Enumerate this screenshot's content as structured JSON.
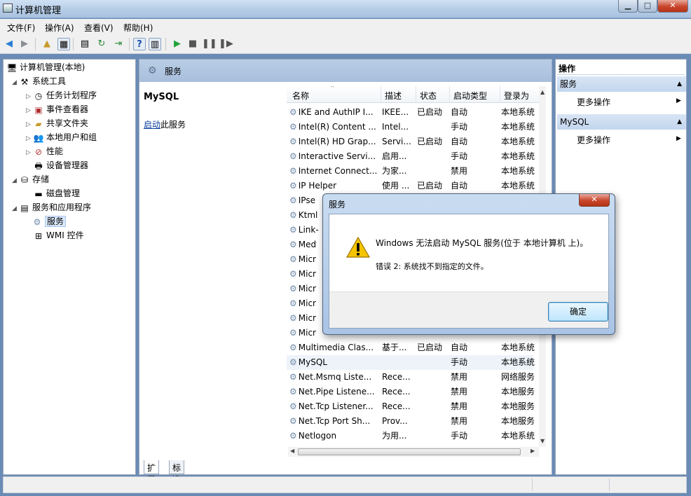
{
  "window": {
    "title": "计算机管理",
    "min": "▁",
    "max": "□",
    "close": "✕"
  },
  "menu": [
    "文件(F)",
    "操作(A)",
    "查看(V)",
    "帮助(H)"
  ],
  "tree": [
    {
      "label": "计算机管理(本地)",
      "icon": "computer-management-icon"
    },
    {
      "label": "系统工具",
      "icon": "tools-icon"
    },
    {
      "label": "任务计划程序",
      "icon": "task-scheduler-icon"
    },
    {
      "label": "事件查看器",
      "icon": "event-viewer-icon"
    },
    {
      "label": "共享文件夹",
      "icon": "shared-folder-icon"
    },
    {
      "label": "本地用户和组",
      "icon": "users-icon"
    },
    {
      "label": "性能",
      "icon": "performance-icon"
    },
    {
      "label": "设备管理器",
      "icon": "device-manager-icon"
    },
    {
      "label": "存储",
      "icon": "storage-icon"
    },
    {
      "label": "磁盘管理",
      "icon": "disk-icon"
    },
    {
      "label": "服务和应用程序",
      "icon": "services-apps-icon"
    },
    {
      "label": "服务",
      "icon": "services-icon"
    },
    {
      "label": "WMI 控件",
      "icon": "wmi-icon"
    }
  ],
  "mid": {
    "header_title": "服务",
    "detail_name": "MySQL",
    "detail_link": "启动",
    "detail_link_suffix": "此服务",
    "columns": [
      "名称",
      "描述",
      "状态",
      "启动类型",
      "登录为"
    ],
    "rows": [
      [
        "IKE and AuthIP I...",
        "IKEE...",
        "已启动",
        "自动",
        "本地系统"
      ],
      [
        "Intel(R) Content ...",
        "Intel...",
        "",
        "手动",
        "本地系统"
      ],
      [
        "Intel(R) HD Grap...",
        "Servi...",
        "已启动",
        "自动",
        "本地系统"
      ],
      [
        "Interactive Servi...",
        "启用...",
        "",
        "手动",
        "本地系统"
      ],
      [
        "Internet Connect...",
        "为家...",
        "",
        "禁用",
        "本地系统"
      ],
      [
        "IP Helper",
        "使用 ...",
        "已启动",
        "自动",
        "本地系统"
      ],
      [
        "IPse",
        "",
        "",
        "",
        ""
      ],
      [
        "Ktml",
        "",
        "",
        "",
        ""
      ],
      [
        "Link-",
        "",
        "",
        "",
        ""
      ],
      [
        "Med",
        "",
        "",
        "",
        ""
      ],
      [
        "Micr",
        "",
        "",
        "",
        ""
      ],
      [
        "Micr",
        "",
        "",
        "",
        ""
      ],
      [
        "Micr",
        "",
        "",
        "",
        ""
      ],
      [
        "Micr",
        "",
        "",
        "",
        ""
      ],
      [
        "Micr",
        "",
        "",
        "",
        ""
      ],
      [
        "Micr",
        "",
        "",
        "",
        ""
      ],
      [
        "Multimedia Clas...",
        "基于...",
        "已启动",
        "自动",
        "本地系统"
      ],
      [
        "MySQL",
        "",
        "",
        "手动",
        "本地系统"
      ],
      [
        "Net.Msmq Liste...",
        "Rece...",
        "",
        "禁用",
        "网络服务"
      ],
      [
        "Net.Pipe Listene...",
        "Rece...",
        "",
        "禁用",
        "本地服务"
      ],
      [
        "Net.Tcp Listener...",
        "Rece...",
        "",
        "禁用",
        "本地服务"
      ],
      [
        "Net.Tcp Port Sh...",
        "Prov...",
        "",
        "禁用",
        "本地服务"
      ],
      [
        "Netlogon",
        "为用...",
        "",
        "手动",
        "本地系统"
      ]
    ],
    "tabs": [
      "扩展",
      "标准"
    ]
  },
  "actions": {
    "header": "操作",
    "sections": [
      {
        "title": "服务",
        "item": "更多操作"
      },
      {
        "title": "MySQL",
        "item": "更多操作"
      }
    ]
  },
  "dialog": {
    "title": "服务",
    "close": "✕",
    "message": "Windows 无法启动 MySQL 服务(位于 本地计算机 上)。",
    "error": "错误 2: 系统找不到指定的文件。",
    "ok": "确定"
  },
  "colors": {
    "header_blue": "#b9cde5",
    "selection": "#d9e8fb",
    "link": "#0a3f9e",
    "close_red": "#c8452c"
  }
}
